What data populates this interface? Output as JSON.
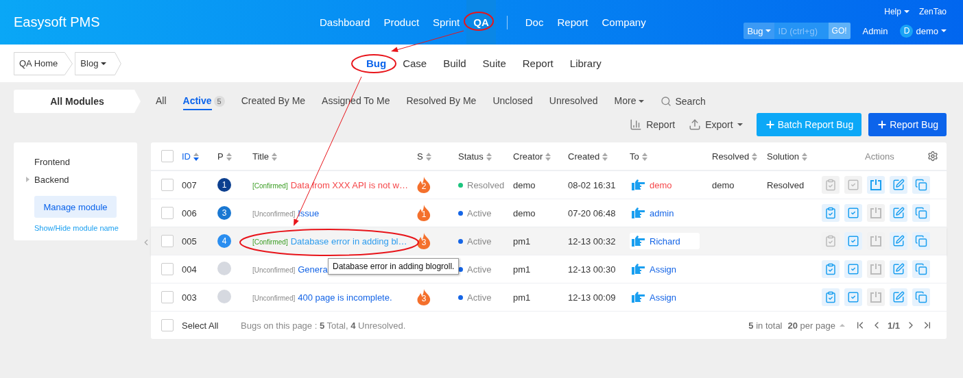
{
  "header": {
    "brand": "Easysoft PMS",
    "nav": [
      {
        "label": "Dashboard",
        "selected": false
      },
      {
        "label": "Product",
        "selected": false
      },
      {
        "label": "Sprint",
        "selected": false
      },
      {
        "label": "QA",
        "selected": true
      }
    ],
    "nav_more": [
      {
        "label": "Doc",
        "selected": false
      },
      {
        "label": "Report",
        "selected": false
      },
      {
        "label": "Company",
        "selected": false
      }
    ],
    "help": "Help",
    "zentao": "ZenTao",
    "search": {
      "type": "Bug",
      "placeholder": "ID (ctrl+g)",
      "go": "GO!"
    },
    "admin": "Admin",
    "user": {
      "initial": "D",
      "name": "demo"
    }
  },
  "breadcrumbs": [
    {
      "label": "QA Home",
      "dropdown": false
    },
    {
      "label": "Blog",
      "dropdown": true
    }
  ],
  "subnav": [
    {
      "label": "Bug",
      "selected": true
    },
    {
      "label": "Case",
      "selected": false
    },
    {
      "label": "Build",
      "selected": false
    },
    {
      "label": "Suite",
      "selected": false
    },
    {
      "label": "Report",
      "selected": false
    },
    {
      "label": "Library",
      "selected": false
    }
  ],
  "modules_title": "All Modules",
  "filters": [
    {
      "label": "All",
      "selected": false
    },
    {
      "label": "Active",
      "selected": true,
      "count": "5"
    },
    {
      "label": "Created By Me",
      "selected": false
    },
    {
      "label": "Assigned To Me",
      "selected": false
    },
    {
      "label": "Resolved By Me",
      "selected": false
    },
    {
      "label": "Unclosed",
      "selected": false
    },
    {
      "label": "Unresolved",
      "selected": false
    },
    {
      "label": "More",
      "selected": false,
      "dropdown": true
    }
  ],
  "search_label": "Search",
  "toolbar": {
    "report": "Report",
    "export": "Export",
    "batch": "Batch Report Bug",
    "create": "Report Bug"
  },
  "sidebar": {
    "items": [
      {
        "label": "Frontend",
        "kind": "leaf"
      },
      {
        "label": "Backend",
        "kind": "branch"
      }
    ],
    "manage": "Manage module",
    "toggle": "Show/Hide module name"
  },
  "table": {
    "columns": [
      {
        "label": "ID",
        "sorted": true
      },
      {
        "label": "P",
        "sorted": false
      },
      {
        "label": "Title",
        "sorted": false
      },
      {
        "label": "S",
        "sorted": false
      },
      {
        "label": "Status",
        "sorted": false
      },
      {
        "label": "Creator",
        "sorted": false
      },
      {
        "label": "Created",
        "sorted": false
      },
      {
        "label": "To",
        "sorted": false
      },
      {
        "label": "Resolved",
        "sorted": false
      },
      {
        "label": "Solution",
        "sorted": false
      }
    ],
    "actions_label": "Actions",
    "all_checked": false,
    "rows": [
      {
        "checked": false,
        "id": "007",
        "priority": {
          "label": "1",
          "color": "#0c3f8f"
        },
        "confirmed": true,
        "tag": "[Confirmed]",
        "title": {
          "text": "Data from XXX API is not w…",
          "color": "#f5474a"
        },
        "severity": "2",
        "status": {
          "label": "Resolved",
          "color": "#1cc47e"
        },
        "creator": "demo",
        "created": "08-02 16:31",
        "to": {
          "label": "demo",
          "color": "#f5474a"
        },
        "resolved": "demo",
        "solution": "Resolved",
        "hovered": false,
        "actions": [
          {
            "kind": "confirm",
            "disabled": true
          },
          {
            "kind": "resolve",
            "disabled": true
          },
          {
            "kind": "close",
            "disabled": false
          },
          {
            "kind": "edit",
            "disabled": false
          },
          {
            "kind": "copy",
            "disabled": false
          }
        ]
      },
      {
        "checked": false,
        "id": "006",
        "priority": {
          "label": "3",
          "color": "#1a78d2"
        },
        "confirmed": false,
        "tag": "[Unconfirmed]",
        "title": {
          "text": "Issue",
          "color": "#1565e6"
        },
        "severity": "1",
        "status": {
          "label": "Active",
          "color": "#1565e6"
        },
        "creator": "demo",
        "created": "07-20 06:48",
        "to": {
          "label": "admin",
          "color": "#1565e6"
        },
        "hovered": false,
        "actions": [
          {
            "kind": "confirm",
            "disabled": false
          },
          {
            "kind": "resolve",
            "disabled": false
          },
          {
            "kind": "close",
            "disabled": true
          },
          {
            "kind": "edit",
            "disabled": false
          },
          {
            "kind": "copy",
            "disabled": false
          }
        ]
      },
      {
        "checked": false,
        "id": "005",
        "priority": {
          "label": "4",
          "color": "#2a8ef0"
        },
        "confirmed": true,
        "tag": "[Confirmed]",
        "title": {
          "text": "Database error in adding bl…",
          "color": "#2d9cee"
        },
        "severity": "3",
        "status": {
          "label": "Active",
          "color": "#1565e6"
        },
        "creator": "pm1",
        "created": "12-13 00:32",
        "to": {
          "label": "Richard",
          "color": "#1565e6"
        },
        "hovered": true,
        "tooltip": "Database error in adding blogroll.",
        "actions": [
          {
            "kind": "confirm",
            "disabled": true
          },
          {
            "kind": "resolve",
            "disabled": false
          },
          {
            "kind": "close",
            "disabled": true
          },
          {
            "kind": "edit",
            "disabled": false
          },
          {
            "kind": "copy",
            "disabled": false
          }
        ]
      },
      {
        "checked": false,
        "id": "004",
        "priority": {
          "color": "#d6d9e0"
        },
        "confirmed": false,
        "tag": "[Unconfirmed]",
        "title": {
          "text": "Genera",
          "color": "#1565e6"
        },
        "status": {
          "label": "Active",
          "color": "#1565e6"
        },
        "creator": "pm1",
        "created": "12-13 00:30",
        "to": {
          "label": "Assign",
          "color": "#1565e6"
        },
        "hovered": false,
        "actions": [
          {
            "kind": "confirm",
            "disabled": false
          },
          {
            "kind": "resolve",
            "disabled": false
          },
          {
            "kind": "close",
            "disabled": true
          },
          {
            "kind": "edit",
            "disabled": false
          },
          {
            "kind": "copy",
            "disabled": false
          }
        ]
      },
      {
        "checked": false,
        "id": "003",
        "priority": {
          "color": "#d6d9e0"
        },
        "confirmed": false,
        "tag": "[Unconfirmed]",
        "title": {
          "text": "400 page is incomplete.",
          "color": "#1565e6"
        },
        "severity": "3",
        "status": {
          "label": "Active",
          "color": "#1565e6"
        },
        "creator": "pm1",
        "created": "12-13 00:09",
        "to": {
          "label": "Assign",
          "color": "#1565e6"
        },
        "hovered": false,
        "actions": [
          {
            "kind": "confirm",
            "disabled": false
          },
          {
            "kind": "resolve",
            "disabled": false
          },
          {
            "kind": "close",
            "disabled": true
          },
          {
            "kind": "edit",
            "disabled": false
          },
          {
            "kind": "copy",
            "disabled": false
          }
        ]
      }
    ]
  },
  "footer": {
    "select_all": "Select All",
    "checked": false,
    "summary": "Bugs on this page : **5** Total, **4** Unresolved.",
    "total": "**5** in total",
    "per_page": "**20** per page",
    "page": "1/1"
  }
}
